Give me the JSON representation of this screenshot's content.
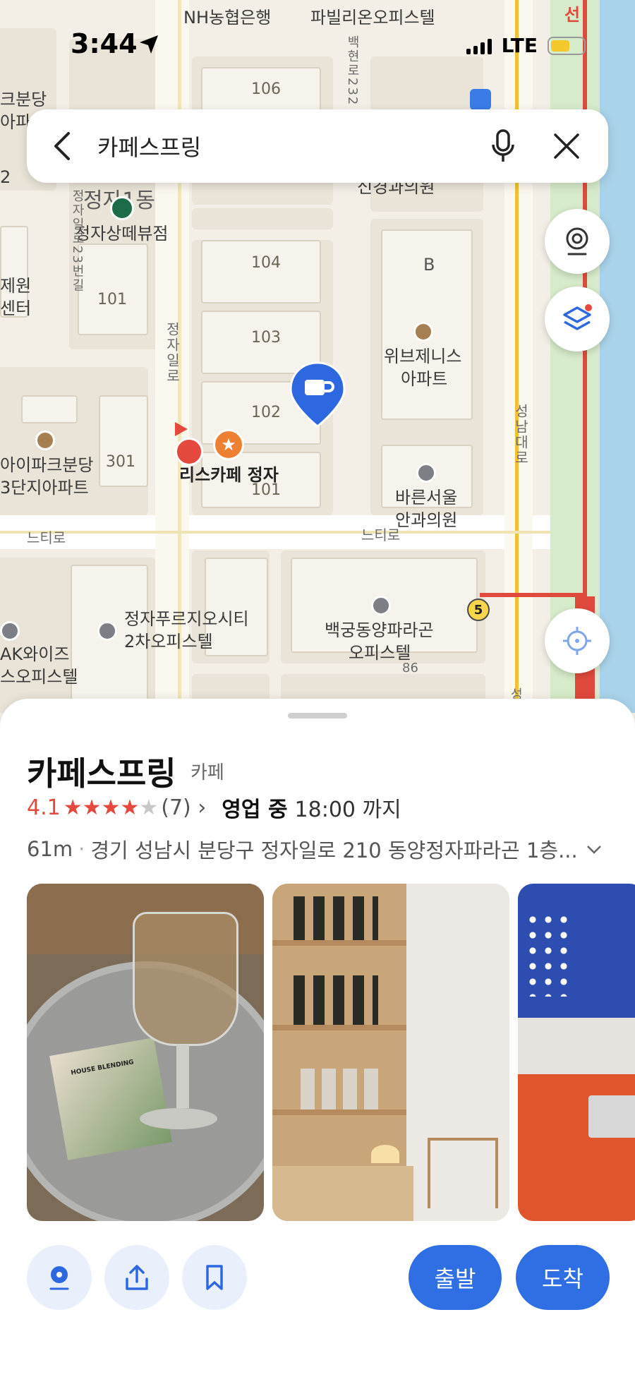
{
  "status_bar": {
    "time": "3:44",
    "network": "LTE"
  },
  "search": {
    "query": "카페스프링"
  },
  "map": {
    "labels": {
      "nh_bank": "NH농협은행",
      "pavilion": "파빌리온오피스텔",
      "bundang_top": "크분당",
      "apa": "아파",
      "num_2": "2",
      "jeongja1dong": "정자1동",
      "jeongja_sangte": "정자상떼뷰점",
      "center_jewon": "제원",
      "center_label": "센터",
      "clinic_top": "신경과의원",
      "wibrjenis": "위브제니스",
      "apartment": "아파트",
      "bldg_b": "B",
      "ipark_bundang": "아이파크분당",
      "ipark_3danji": "3단지아파트",
      "rees_cafe": "리스카페 정자",
      "bareun_seoul": "바른서울",
      "eye_clinic": "안과의원",
      "jeongja_prugio": "정자푸르지오시티",
      "prugio_2": "2차오피스텔",
      "baekgung": "백궁동양파라곤",
      "officetel": "오피스텔",
      "ak_wise": "AK와이즈",
      "ak_officetel": "스오피스텔",
      "exit_5": "5",
      "line_char": "선"
    },
    "buildings": {
      "b106": "106",
      "b104": "104",
      "b103": "103",
      "b102": "102",
      "b101a": "101",
      "b101b": "101",
      "b301": "301"
    },
    "roads": {
      "jeongja_il_ro": "정자일로",
      "neuti_ro_left": "느티로",
      "neuti_ro_mid": "느티로",
      "seongnam_daero": "성남대로",
      "jeongja_il_ro_23": "정자일로23번길",
      "baekgung_232": "백현로232",
      "road_98": "86",
      "road_seong": "성"
    }
  },
  "place": {
    "name": "카페스프링",
    "category": "카페",
    "rating": "4.1",
    "stars": 4,
    "review_count": "(7)",
    "review_chevron": "›",
    "open_status": "영업 중",
    "hours": "18:00 까지",
    "distance": "61m",
    "address": "경기 성남시 분당구 정자일로 210 동양정자파라곤 1층..."
  },
  "photo_text": {
    "coaster": "HOUSE BLENDING"
  },
  "actions": {
    "depart": "출발",
    "arrive": "도착"
  },
  "colors": {
    "accent": "#2f6fe3",
    "rating": "#e5483c",
    "marker": "#2e68e0"
  }
}
